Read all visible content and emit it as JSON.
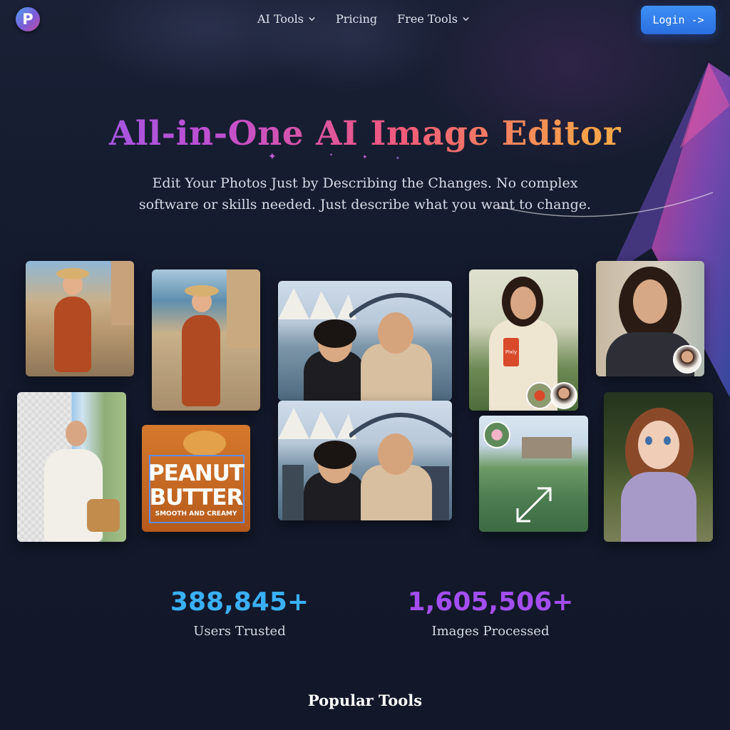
{
  "header": {
    "logo_letter": "P",
    "nav": [
      {
        "label": "AI Tools",
        "has_dropdown": true
      },
      {
        "label": "Pricing",
        "has_dropdown": false
      },
      {
        "label": "Free Tools",
        "has_dropdown": true
      }
    ],
    "login_label": "Login ->"
  },
  "hero": {
    "title": "All-in-One AI Image Editor",
    "subtitle": "Edit Your Photos Just by Describing the Changes. No complex software or skills needed. Just describe what you want to change."
  },
  "gallery": {
    "product_label": {
      "line1": "PEANUT",
      "line2": "BUTTER",
      "line3": "SMOOTH AND CREAMY"
    },
    "can_label": "Pixly"
  },
  "stats": [
    {
      "value": "388,845+",
      "label": "Users Trusted",
      "color": "#3ab0f5"
    },
    {
      "value": "1,605,506+",
      "label": "Images Processed",
      "color": "#a34ef0"
    }
  ],
  "sections": {
    "popular_tools": "Popular Tools"
  },
  "colors": {
    "background": "#131a2e",
    "accent": "#2a6fe0"
  }
}
